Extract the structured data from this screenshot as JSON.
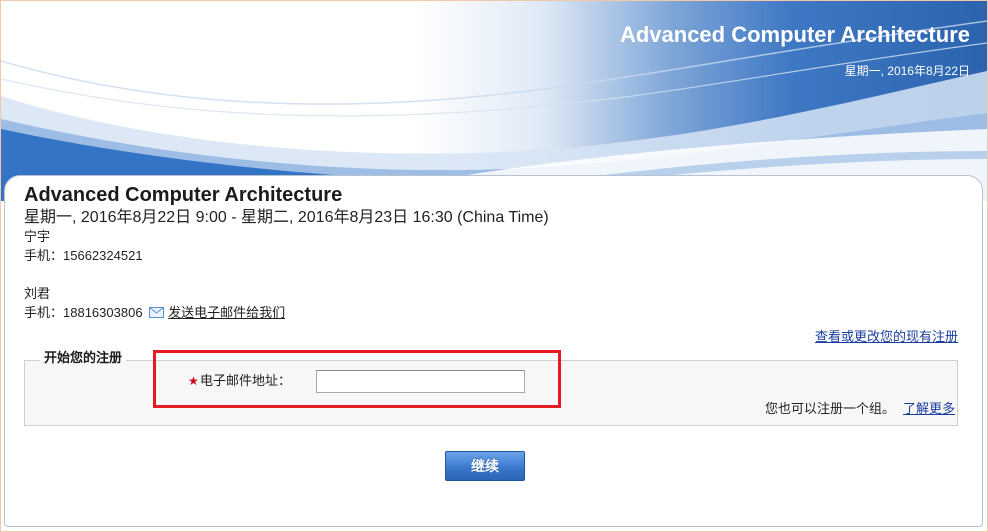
{
  "banner": {
    "title": "Advanced Computer Architecture",
    "date": "星期一, 2016年8月22日"
  },
  "event": {
    "title": "Advanced Computer Architecture",
    "datetime": "星期一, 2016年8月22日 9:00 - 星期二, 2016年8月23日 16:30 (China Time)",
    "contacts": [
      {
        "name": "宁宇",
        "phone_label": "手机：",
        "phone": "15662324521"
      },
      {
        "name": "刘君",
        "phone_label": "手机：",
        "phone": "18816303806"
      }
    ],
    "email_link": "发送电子邮件给我们"
  },
  "links": {
    "view_change": "查看或更改您的现有注册"
  },
  "registration": {
    "legend": "开始您的注册",
    "required_marker": "★",
    "email_label": "电子邮件地址：",
    "email_value": "",
    "group_text": "您也可以注册一个组。",
    "learn_more": "了解更多"
  },
  "continue_button": "继续",
  "icons": {
    "email": "envelope-icon"
  },
  "colors": {
    "link": "#1a3da0",
    "required": "#d0021b",
    "annotation": "#e31b23",
    "button": "#3a78cc",
    "banner": "#2b63ae"
  }
}
